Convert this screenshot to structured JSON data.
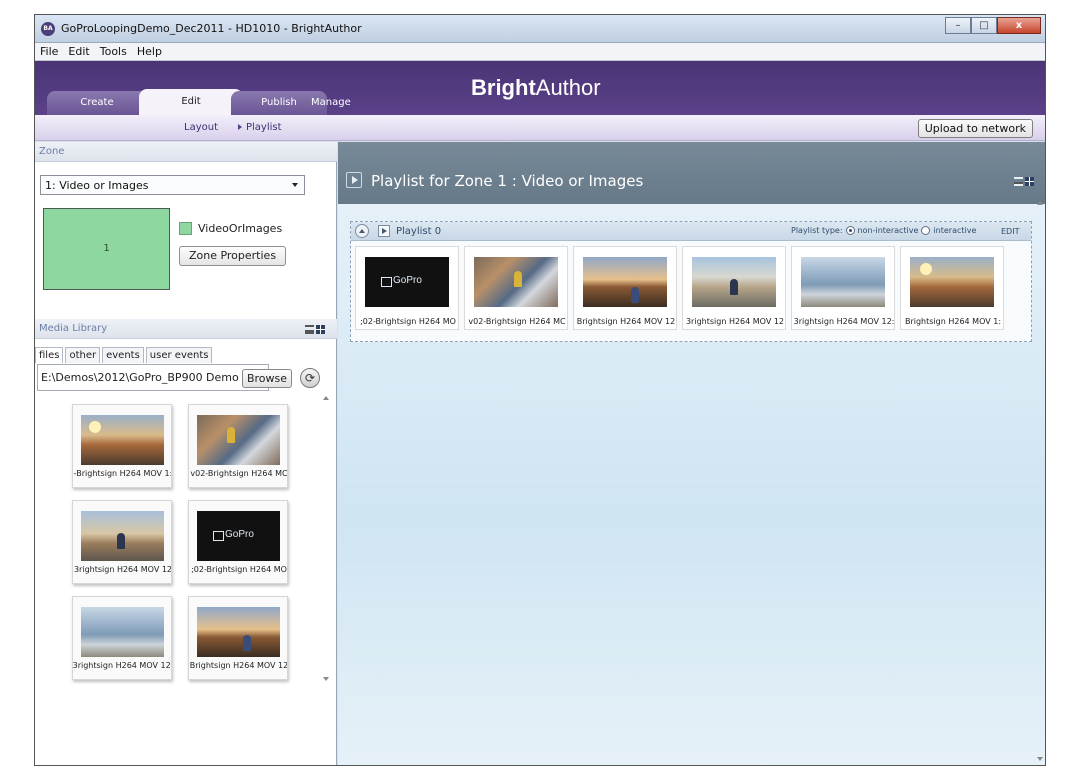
{
  "window": {
    "title": "GoProLoopingDemo_Dec2011 - HD1010 - BrightAuthor",
    "app_icon_text": "BA",
    "minimize": "–",
    "maximize": "□",
    "close": "x"
  },
  "menu": [
    "File",
    "Edit",
    "Tools",
    "Help"
  ],
  "header": {
    "brand_bold": "Bright",
    "brand_rest": "Author",
    "tabs": [
      {
        "label": "Create",
        "active": false
      },
      {
        "label": "Edit",
        "active": true
      },
      {
        "label": "Publish",
        "active": false
      },
      {
        "label": "Manage",
        "active": false
      }
    ]
  },
  "subnav": {
    "layout": "Layout",
    "playlist": "Playlist",
    "upload": "Upload to network"
  },
  "zone": {
    "section_label": "Zone",
    "selected": "1: Video or Images",
    "thumb_label": "1",
    "name": "VideoOrImages",
    "properties_button": "Zone Properties"
  },
  "media_library": {
    "section_label": "Media Library",
    "tabs": [
      "files",
      "other",
      "events",
      "user events"
    ],
    "path": "E:\\Demos\\2012\\GoPro_BP900 Demo",
    "browse": "Browse",
    "items": [
      {
        "caption": "-Brightsign H264 MOV 1:",
        "img": "img-cliff"
      },
      {
        "caption": "v02-Brightsign H264 MC",
        "img": "img-bike"
      },
      {
        "caption": "3rightsign H264 MOV 12",
        "img": "img-rider"
      },
      {
        "caption": ";02-Brightsign H264 MO",
        "img": "img-black"
      },
      {
        "caption": "3rightsign H264 MOV 12:",
        "img": "img-sea"
      },
      {
        "caption": "Brightsign H264 MOV 12",
        "img": "img-sunset"
      }
    ]
  },
  "playlist": {
    "title": "Playlist for Zone 1 : Video or Images",
    "name": "Playlist 0",
    "type_label": "Playlist type:",
    "option_non_interactive": "non-interactive",
    "option_interactive": "interactive",
    "edit": "EDIT",
    "items": [
      {
        "caption": ";02-Brightsign H264 MO",
        "img": "img-black"
      },
      {
        "caption": "v02-Brightsign H264 MC",
        "img": "img-bike"
      },
      {
        "caption": "Brightsign H264 MOV 12",
        "img": "img-sunset"
      },
      {
        "caption": "3rightsign H264 MOV 12",
        "img": "img-road"
      },
      {
        "caption": "3rightsign H264 MOV 12:",
        "img": "img-sea"
      },
      {
        "caption": "Brightsign H264 MOV 1:",
        "img": "img-cliff"
      }
    ]
  },
  "colors": {
    "header_purple": "#4a3475",
    "zone_green": "#8fd7a0",
    "playlist_header": "#6f8290"
  }
}
